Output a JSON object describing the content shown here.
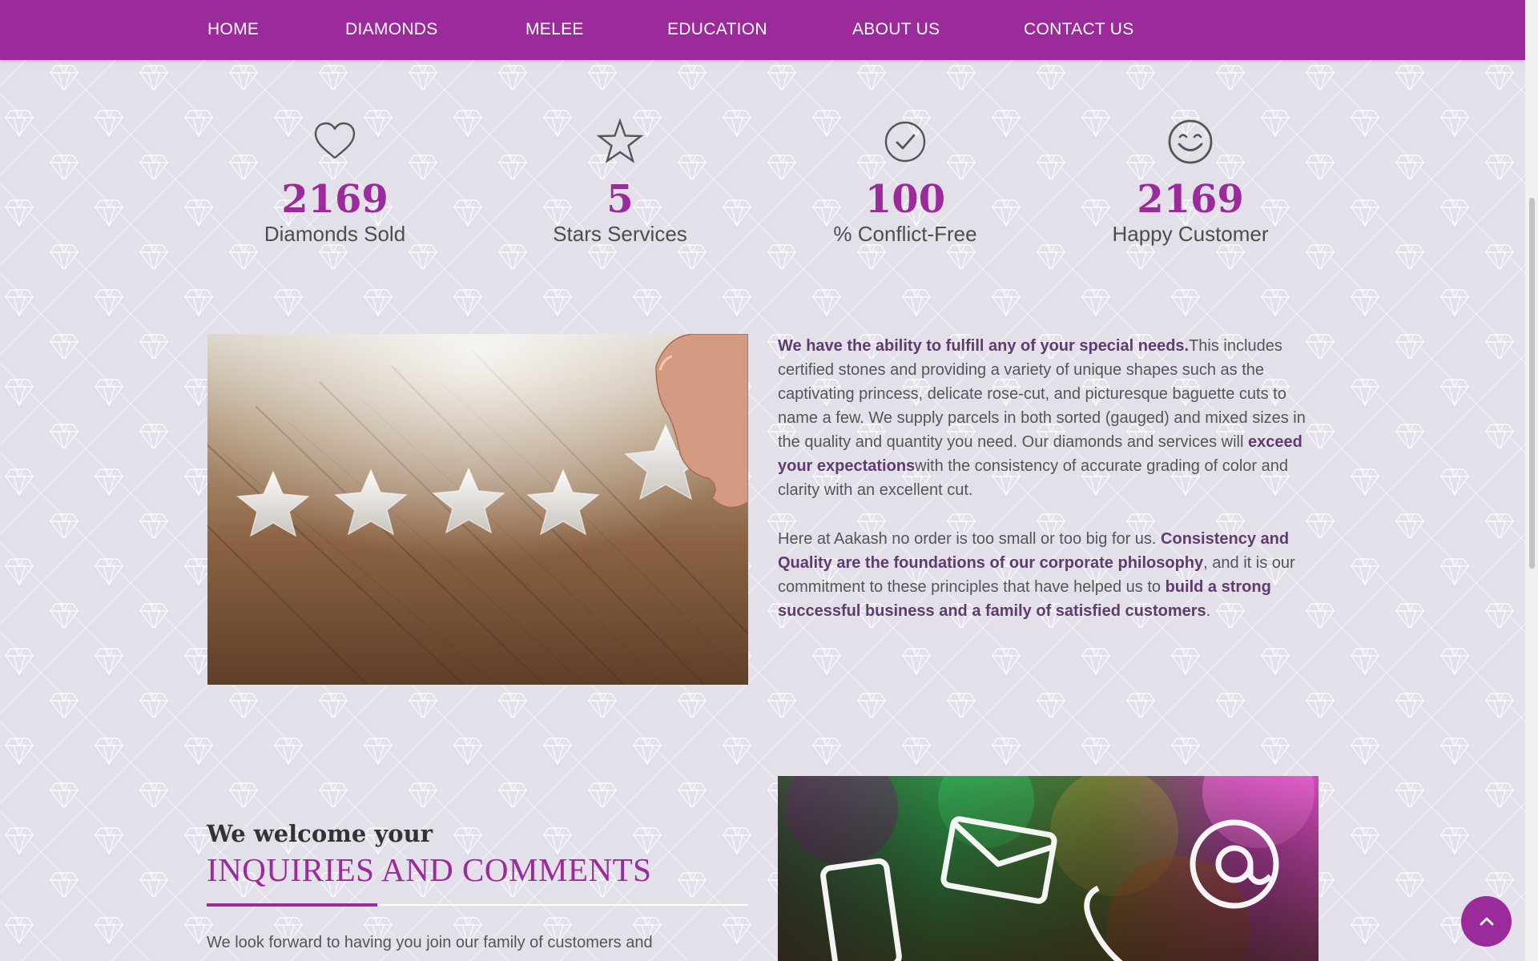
{
  "nav": {
    "items": [
      {
        "label": "HOME"
      },
      {
        "label": "DIAMONDS"
      },
      {
        "label": "MELEE"
      },
      {
        "label": "EDUCATION"
      },
      {
        "label": "ABOUT US"
      },
      {
        "label": "CONTACT US"
      }
    ]
  },
  "stats": [
    {
      "icon": "heart-icon",
      "number": "2169",
      "label": "Diamonds Sold"
    },
    {
      "icon": "star-icon",
      "number": "5",
      "label": "Stars Services"
    },
    {
      "icon": "check-circle-icon",
      "number": "100",
      "label": "% Conflict-Free"
    },
    {
      "icon": "smiley-icon",
      "number": "2169",
      "label": "Happy Customer"
    }
  ],
  "about": {
    "p1_bold1": "We have the ability to fulfill any of your special needs.",
    "p1_text1": "This includes certified stones and providing a variety of unique shapes such as the captivating princess, delicate rose-cut, and picturesque baguette cuts to name a few. We supply parcels in both sorted (gauged) and mixed sizes in the quality and quantity you need. Our diamonds and services will ",
    "p1_bold2": "exceed your expectations",
    "p1_text2": "with the consistency of accurate grading of color and clarity with an excellent cut.",
    "p2_text1": "Here at Aakash no order is too small or too big for us. ",
    "p2_bold1": "Consistency and Quality are the foundations of our corporate philosophy",
    "p2_text2": ", and it is our commitment to these principles that have helped us to ",
    "p2_bold2": "build a strong successful business and a family of satisfied customers",
    "p2_text3": "."
  },
  "inquiries": {
    "small_heading": "We welcome your",
    "large_heading": "INQUIRIES AND COMMENTS",
    "text": "We look forward to having you join our family of customers and"
  },
  "colors": {
    "accent": "#9b2a9b",
    "background": "#e3e0ea",
    "text": "#555555",
    "bold_text": "#5e3c6e"
  },
  "icons": {
    "scroll_top": "chevron-up-icon"
  }
}
